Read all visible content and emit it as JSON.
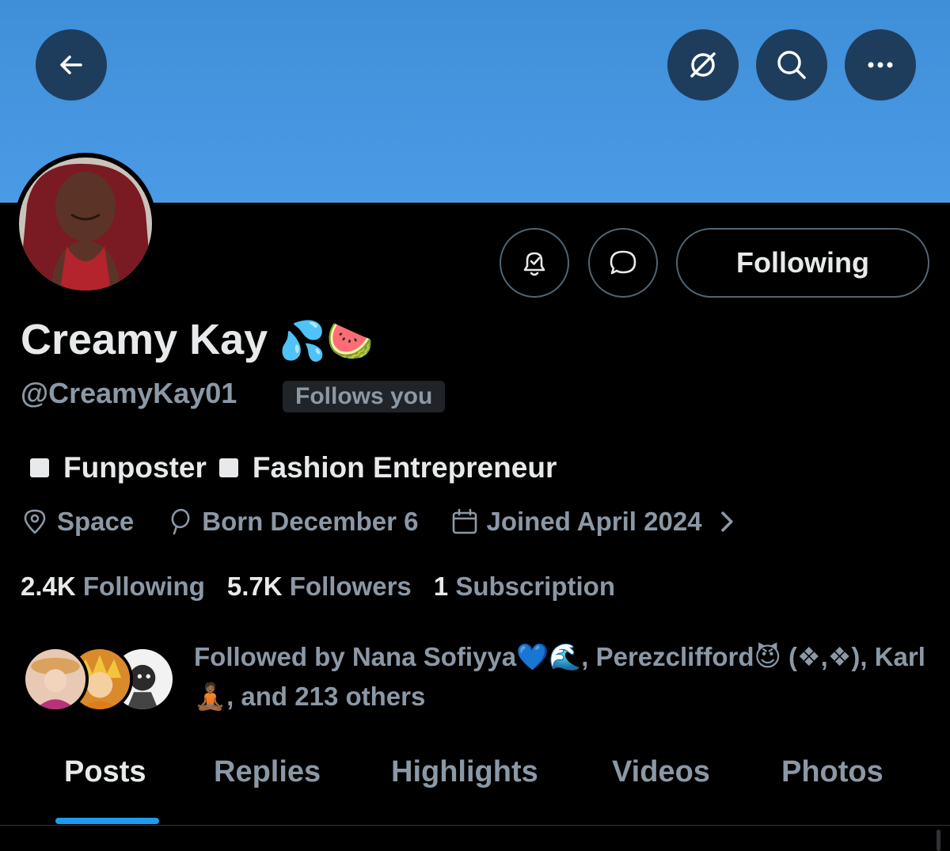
{
  "header": {
    "back_icon": "arrow-left-icon",
    "grok_icon": "grok-icon",
    "search_icon": "search-icon",
    "more_icon": "ellipsis-icon"
  },
  "profile": {
    "name": "Creamy Kay",
    "name_emojis": "💦🍉",
    "handle": "@CreamyKay01",
    "follows_you": "Follows you",
    "following_button": "Following",
    "bio": {
      "item1": "Funposter",
      "item2": "Fashion Entrepreneur"
    },
    "meta": {
      "location": "Space",
      "born": "Born December 6",
      "joined": "Joined April 2024"
    },
    "stats": {
      "following_count": "2.4K",
      "following_label": "Following",
      "followers_count": "5.7K",
      "followers_label": "Followers",
      "subscription_count": "1",
      "subscription_label": "Subscription"
    },
    "followed_by": "Followed by Nana Sofiyya💙🌊, Perezclifford😈 (❖,❖), Karl 🧘🏾, and 213 others"
  },
  "tabs": [
    "Posts",
    "Replies",
    "Highlights",
    "Videos",
    "Photos"
  ],
  "colors": {
    "banner": "#4a9ae6",
    "accent": "#1d9bf0",
    "muted_text": "#8b98a5"
  }
}
